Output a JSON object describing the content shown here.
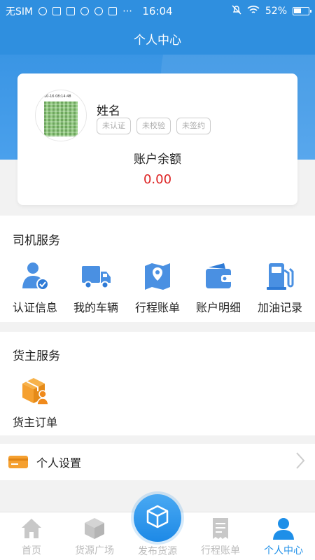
{
  "status_bar": {
    "carrier": "无SIM",
    "time": "16:04",
    "battery": "52%"
  },
  "header": {
    "title": "个人中心"
  },
  "profile": {
    "avatar_timestamp": "10-16 08:14:48",
    "name": "姓名",
    "tags": [
      "未认证",
      "未校验",
      "未签约"
    ],
    "balance_label": "账户余额",
    "balance_value": "0.00"
  },
  "driver_services": {
    "title": "司机服务",
    "items": [
      {
        "label": "认证信息",
        "icon": "user-verified-icon"
      },
      {
        "label": "我的车辆",
        "icon": "truck-icon"
      },
      {
        "label": "行程账单",
        "icon": "map-pin-icon"
      },
      {
        "label": "账户明细",
        "icon": "wallet-icon"
      },
      {
        "label": "加油记录",
        "icon": "fuel-pump-icon"
      }
    ]
  },
  "shipper_services": {
    "title": "货主服务",
    "items": [
      {
        "label": "货主订单",
        "icon": "box-user-icon"
      }
    ]
  },
  "settings": {
    "label": "个人设置",
    "icon": "card-icon"
  },
  "tabbar": {
    "items": [
      {
        "label": "首页",
        "icon": "home-icon"
      },
      {
        "label": "货源广场",
        "icon": "cube-icon"
      },
      {
        "label": "发布货源",
        "icon": "cube-icon"
      },
      {
        "label": "行程账单",
        "icon": "receipt-icon"
      },
      {
        "label": "个人中心",
        "icon": "person-icon"
      }
    ],
    "active": "个人中心"
  },
  "colors": {
    "primary": "#2f8fdf",
    "active_tab": "#1e8fe8",
    "balance": "#dd2222",
    "orange": "#f5a030"
  }
}
